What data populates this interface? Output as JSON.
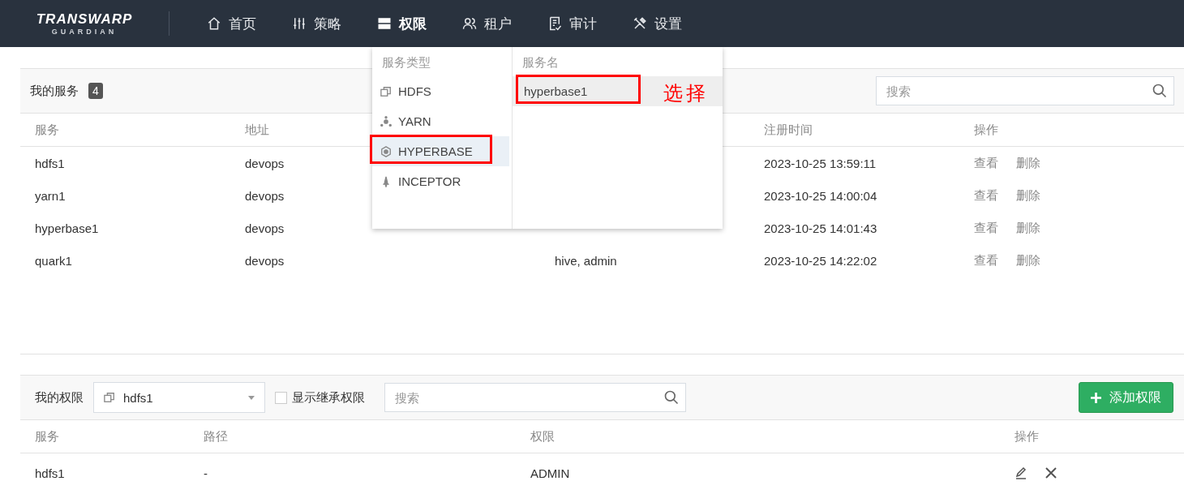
{
  "logo": {
    "title": "TRANSWARP",
    "subtitle": "GUARDIAN"
  },
  "nav": [
    {
      "label": "首页",
      "selected": false
    },
    {
      "label": "策略",
      "selected": false
    },
    {
      "label": "权限",
      "selected": true
    },
    {
      "label": "租户",
      "selected": false
    },
    {
      "label": "审计",
      "selected": false
    },
    {
      "label": "设置",
      "selected": false
    }
  ],
  "dropdown": {
    "type_heading": "服务类型",
    "name_heading": "服务名",
    "types": [
      {
        "label": "HDFS",
        "selected": false,
        "outlined": false
      },
      {
        "label": "YARN",
        "selected": false,
        "outlined": false
      },
      {
        "label": "HYPERBASE",
        "selected": true,
        "outlined": true
      },
      {
        "label": "INCEPTOR",
        "selected": false,
        "outlined": false
      }
    ],
    "names": [
      {
        "label": "hyperbase1",
        "selected": true,
        "outlined": true
      }
    ],
    "annotation": "选择"
  },
  "services": {
    "title": "我的服务",
    "count": "4",
    "search": {
      "placeholder": "搜索"
    },
    "columns": {
      "service": "服务",
      "address": "地址",
      "registered": "注册时间",
      "actions": "操作"
    },
    "rows": [
      {
        "service": "hdfs1",
        "address": "devops",
        "registered": "2023-10-25 13:59:11",
        "actions": [
          "查看",
          "删除"
        ]
      },
      {
        "service": "yarn1",
        "address": "devops",
        "registered": "2023-10-25 14:00:04",
        "actions": [
          "查看",
          "删除"
        ]
      },
      {
        "service": "hyperbase1",
        "address": "devops",
        "registered": "2023-10-25 14:01:43",
        "actions": [
          "查看",
          "删除"
        ]
      },
      {
        "service": "quark1",
        "address": "devops",
        "column_3": "hive, admin",
        "registered": "2023-10-25 14:22:02",
        "actions": [
          "查看",
          "删除"
        ]
      }
    ]
  },
  "permissions": {
    "title": "我的权限",
    "select": {
      "value": "hdfs1"
    },
    "inherit": {
      "label": "显示继承权限",
      "checked": false
    },
    "search": {
      "placeholder": "搜索"
    },
    "add_button": "添加权限",
    "columns": [
      "服务",
      "路径",
      "权限",
      "操作"
    ],
    "rows": [
      {
        "service": "hdfs1",
        "path": "-",
        "permission": "ADMIN"
      }
    ]
  }
}
